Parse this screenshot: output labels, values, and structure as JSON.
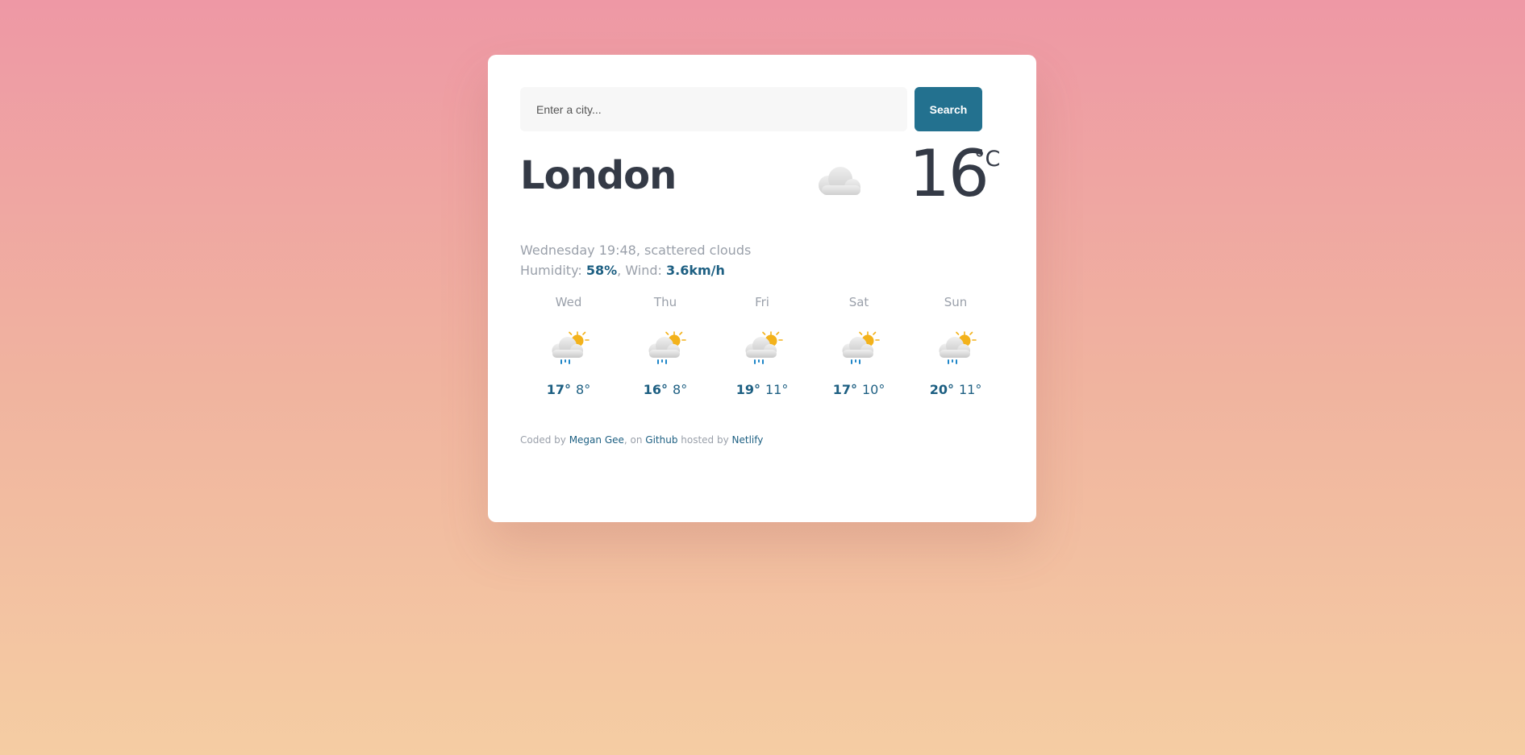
{
  "search": {
    "placeholder": "Enter a city...",
    "value": "",
    "button_label": "Search"
  },
  "current": {
    "city": "London",
    "temperature": "16",
    "unit": "°C",
    "icon": "cloud-icon",
    "description_line": "Wednesday 19:48, scattered clouds",
    "humidity_label": "Humidity: ",
    "humidity_value": "58%",
    "wind_label": ", Wind: ",
    "wind_value": "3.6km/h"
  },
  "forecast": [
    {
      "day": "Wed",
      "max": "17°",
      "min": "8°",
      "icon": "sun-cloud-rain-icon"
    },
    {
      "day": "Thu",
      "max": "16°",
      "min": "8°",
      "icon": "sun-cloud-rain-icon"
    },
    {
      "day": "Fri",
      "max": "19°",
      "min": "11°",
      "icon": "sun-cloud-rain-icon"
    },
    {
      "day": "Sat",
      "max": "17°",
      "min": "10°",
      "icon": "sun-cloud-rain-icon"
    },
    {
      "day": "Sun",
      "max": "20°",
      "min": "11°",
      "icon": "sun-cloud-rain-icon"
    }
  ],
  "footer": {
    "prefix": "Coded by ",
    "author": "Megan Gee",
    "middle": ", on ",
    "repo": "Github",
    "hosted": " hosted by ",
    "host": "Netlify"
  },
  "colors": {
    "accent": "#23718f",
    "text_dark": "#343a46",
    "text_muted": "#9aa0aa",
    "highlight": "#1d5f82"
  }
}
